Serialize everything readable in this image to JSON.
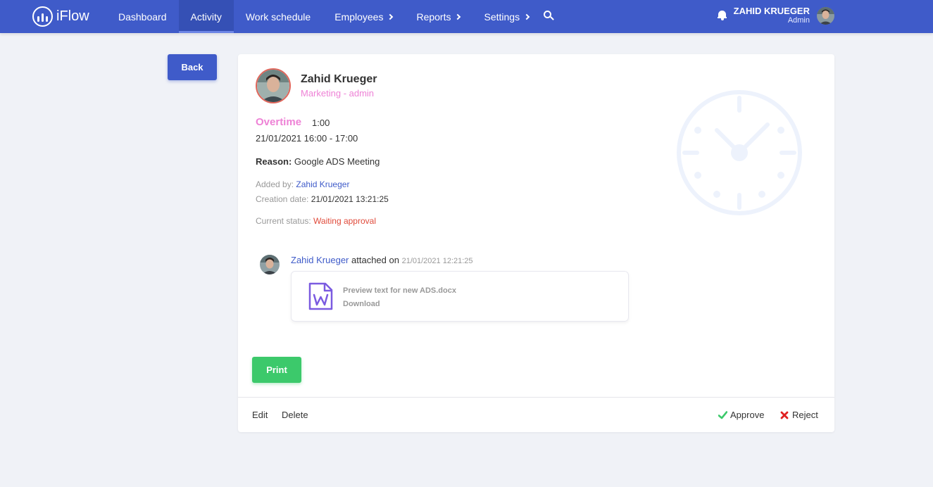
{
  "app": {
    "name": "iFlow"
  },
  "nav": {
    "items": [
      {
        "label": "Dashboard"
      },
      {
        "label": "Activity"
      },
      {
        "label": "Work schedule"
      },
      {
        "label": "Employees"
      },
      {
        "label": "Reports"
      },
      {
        "label": "Settings"
      }
    ]
  },
  "user": {
    "name": "ZAHID KRUEGER",
    "role": "Admin"
  },
  "page": {
    "back_label": "Back",
    "print_label": "Print"
  },
  "profile": {
    "name": "Zahid Krueger",
    "department": "Marketing - admin"
  },
  "request": {
    "type": "Overtime",
    "duration": "1:00",
    "dates": "21/01/2021 16:00 - 17:00",
    "reason_label": "Reason:",
    "reason": "Google ADS Meeting",
    "added_by_label": "Added by:",
    "added_by": "Zahid Krueger",
    "creation_date_label": "Creation date:",
    "creation_date": "21/01/2021 13:21:25",
    "status_label": "Current status:",
    "status": "Waiting approval"
  },
  "attachment": {
    "author": "Zahid Krueger",
    "action": "attached on",
    "date": "21/01/2021 12:21:25",
    "file_name": "Preview text for new ADS.docx",
    "download_label": "Download"
  },
  "footer": {
    "edit_label": "Edit",
    "delete_label": "Delete",
    "approve_label": "Approve",
    "reject_label": "Reject"
  },
  "colors": {
    "primary": "#3f5bc9",
    "accent_pink": "#ee82d6",
    "success": "#3cc96b",
    "danger": "#e04a3a",
    "background": "#f0f2f7"
  }
}
